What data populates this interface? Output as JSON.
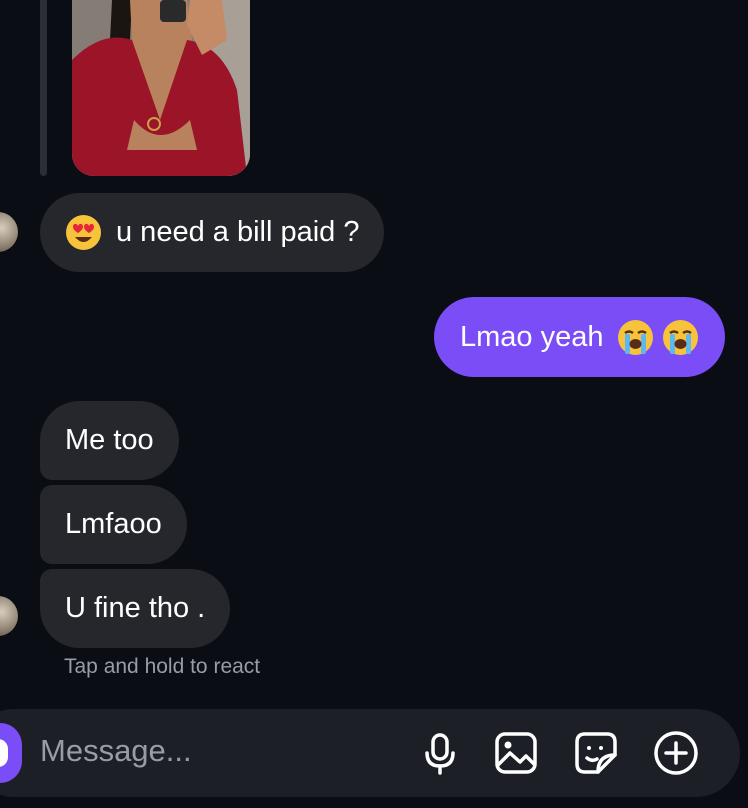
{
  "conversation": {
    "messages": [
      {
        "from": "them",
        "text": "u need a bill paid ?",
        "emoji_icon": "heart-eyes-emoji-icon"
      },
      {
        "from": "me",
        "text": "Lmao yeah",
        "emoji_icons": [
          "loudly-crying-emoji-icon",
          "loudly-crying-emoji-icon"
        ]
      },
      {
        "from": "them",
        "text": "Me too"
      },
      {
        "from": "them",
        "text": "Lmfaoo"
      },
      {
        "from": "them",
        "text": "U fine tho ."
      }
    ],
    "react_hint": "Tap and hold to react"
  },
  "composer": {
    "placeholder": "Message...",
    "icons": [
      "microphone-icon",
      "gallery-icon",
      "sticker-icon",
      "add-circle-icon"
    ]
  },
  "colors": {
    "background": "#0b0d14",
    "received_bubble": "#25272d",
    "sent_bubble": "#7b4df7",
    "composer": "#1d1f26",
    "hint_text": "#9a9ca4"
  }
}
